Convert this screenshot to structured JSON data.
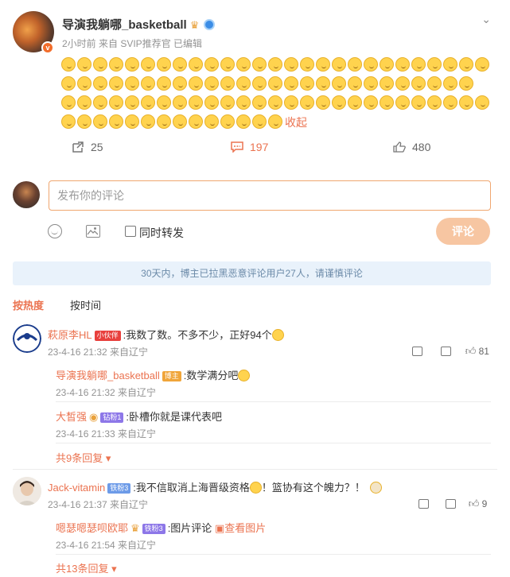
{
  "post": {
    "username": "导演我躺哪_basketball",
    "meta": "2小时前 来自 SVIP推荐官 已编辑",
    "collapse_label": "收起",
    "reposts": "25",
    "comments": "197",
    "likes": "480"
  },
  "composer": {
    "placeholder": "发布你的评论",
    "repost_label": "同时转发",
    "submit_label": "评论"
  },
  "notice": "30天内，博主已拉黑恶意评论用户27人，请谨慎评论",
  "sort": {
    "hot": "按热度",
    "time": "按时间"
  },
  "comments": [
    {
      "name": "萩原李HL",
      "badge": "小伙伴",
      "text": ":我数了数。不多不少，正好94个",
      "time": "23-4-16 21:32 来自辽宁",
      "likes": "81",
      "replies": [
        {
          "name": "导演我躺哪_basketball",
          "badge": "博主",
          "text": ":数学满分吧",
          "time": "23-4-16 21:32 来自辽宁"
        },
        {
          "name": "大皙强",
          "badge": "钻粉1",
          "text": ":卧槽你就是课代表吧",
          "time": "23-4-16 21:33 来自辽宁"
        }
      ],
      "more": "共9条回复"
    },
    {
      "name": "Jack-vitamin",
      "badge": "铁粉3",
      "text": ":我不信取消上海晋级资格",
      "text2": "！篮协有这个魄力？！",
      "time": "23-4-16 21:37 来自辽宁",
      "likes": "9",
      "replies": [
        {
          "name": "嗯瑟嗯瑟呗欧耶",
          "badge": "铁粉3",
          "text": ":图片评论",
          "link": "查看图片",
          "time": "23-4-16 21:54 来自辽宁"
        }
      ],
      "more": "共13条回复"
    }
  ]
}
